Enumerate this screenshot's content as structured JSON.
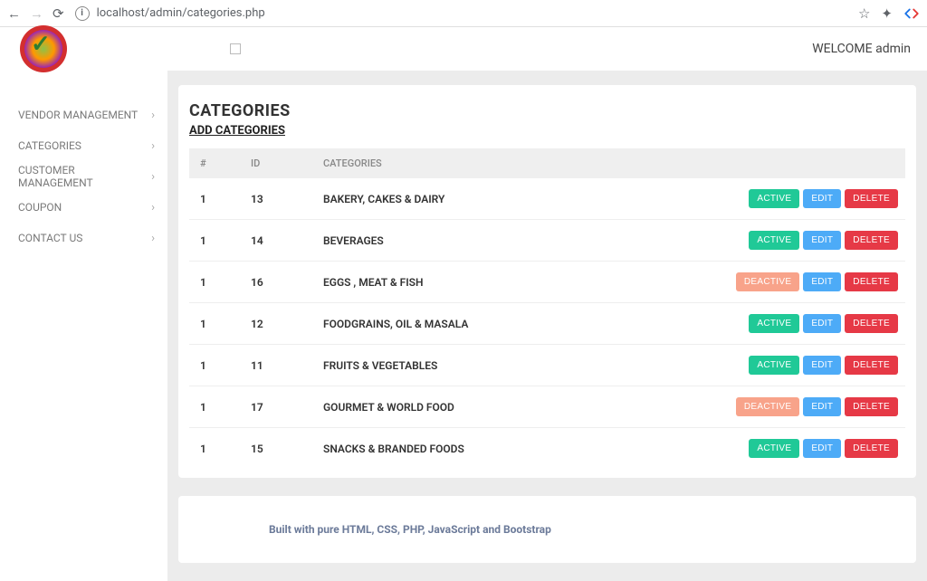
{
  "browser": {
    "url": "localhost/admin/categories.php"
  },
  "header": {
    "welcome": "WELCOME admin"
  },
  "sidebar": {
    "items": [
      {
        "label": "VENDOR MANAGEMENT"
      },
      {
        "label": "CATEGORIES"
      },
      {
        "label": "CUSTOMER MANAGEMENT"
      },
      {
        "label": "COUPON"
      },
      {
        "label": "CONTACT US"
      }
    ]
  },
  "page": {
    "title": "CATEGORIES",
    "add_link": "ADD CATEGORIES",
    "columns": {
      "num": "#",
      "id": "ID",
      "cat": "CATEGORIES",
      "actions": ""
    },
    "rows": [
      {
        "num": "1",
        "id": "13",
        "name": "BAKERY, CAKES & DAIRY",
        "status": "ACTIVE"
      },
      {
        "num": "1",
        "id": "14",
        "name": "BEVERAGES",
        "status": "ACTIVE"
      },
      {
        "num": "1",
        "id": "16",
        "name": "EGGS , MEAT & FISH",
        "status": "DEACTIVE"
      },
      {
        "num": "1",
        "id": "12",
        "name": "FOODGRAINS, OIL & MASALA",
        "status": "ACTIVE"
      },
      {
        "num": "1",
        "id": "11",
        "name": "FRUITS & VEGETABLES",
        "status": "ACTIVE"
      },
      {
        "num": "1",
        "id": "17",
        "name": "GOURMET & WORLD FOOD",
        "status": "DEACTIVE"
      },
      {
        "num": "1",
        "id": "15",
        "name": "SNACKS & BRANDED FOODS",
        "status": "ACTIVE"
      }
    ],
    "buttons": {
      "edit": "EDIT",
      "delete": "DELETE"
    }
  },
  "footer": {
    "text": "Built with pure HTML, CSS, PHP, JavaScript and Bootstrap"
  }
}
